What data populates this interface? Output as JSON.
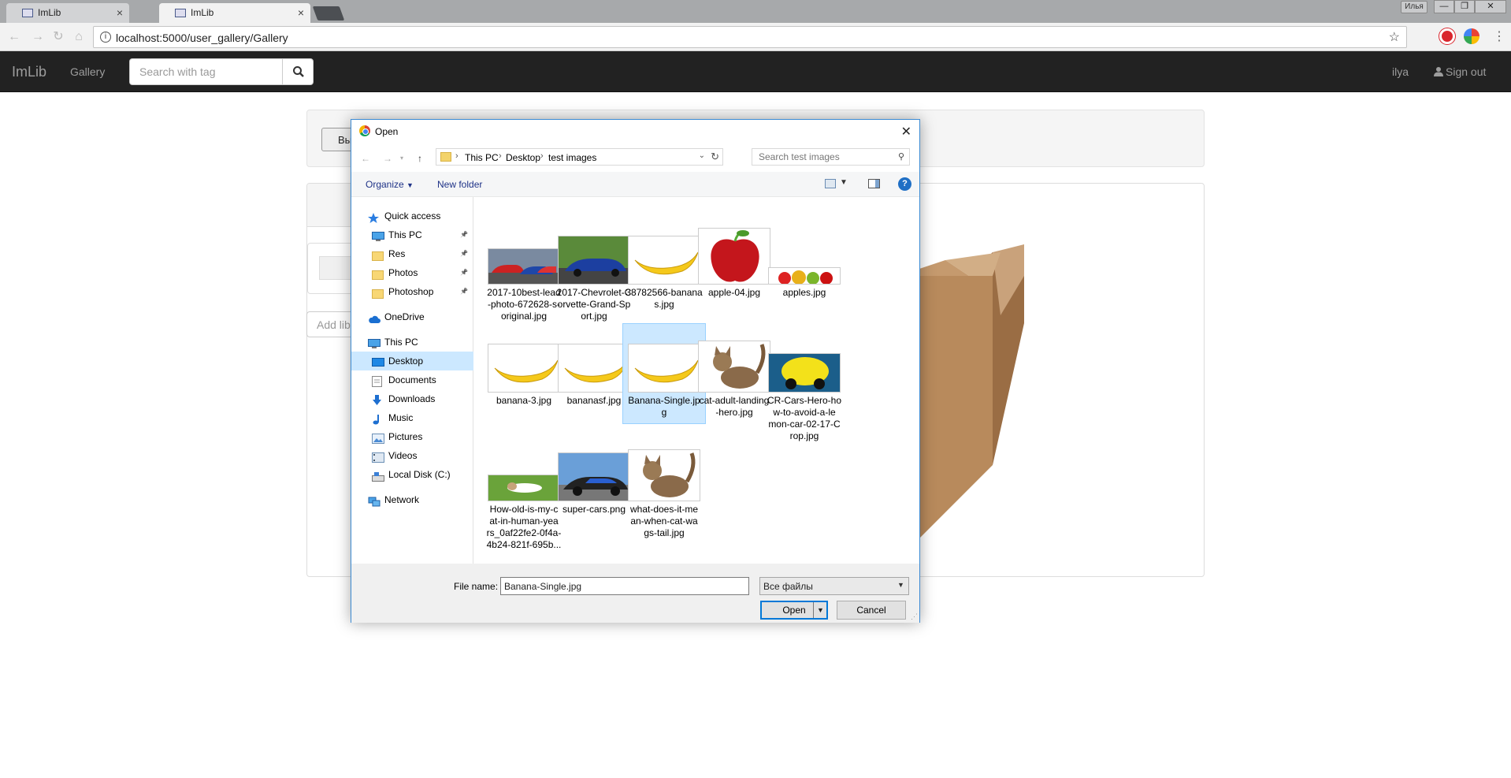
{
  "browser": {
    "tabs": [
      {
        "title": "ImLib",
        "close": "×"
      },
      {
        "title": "ImLib",
        "close": "×"
      }
    ],
    "profile_name": "Илья",
    "window_controls": {
      "minimize": "—",
      "maximize": "❐",
      "close": "✕"
    },
    "url": "localhost:5000/user_gallery/Gallery"
  },
  "site": {
    "brand": "ImLib",
    "nav_gallery": "Gallery",
    "search_placeholder": "Search with tag",
    "user": "ilya",
    "sign_out": "Sign out",
    "upload_button_partial": "Вы",
    "add_lib_partial": "Add lib"
  },
  "dialog": {
    "title": "Open",
    "breadcrumb": [
      "This PC",
      "Desktop",
      "test images"
    ],
    "search_placeholder": "Search test images",
    "organize": "Organize",
    "new_folder": "New folder",
    "help": "?",
    "nav_items": [
      {
        "label": "Quick access",
        "icon": "star-icon",
        "pinned": false
      },
      {
        "label": "This PC",
        "icon": "computer-icon",
        "pinned": true
      },
      {
        "label": "Res",
        "icon": "folder-icon",
        "pinned": true
      },
      {
        "label": "Photos",
        "icon": "folder-icon",
        "pinned": true
      },
      {
        "label": "Photoshop",
        "icon": "folder-icon",
        "pinned": true
      },
      {
        "label": "OneDrive",
        "icon": "cloud-icon",
        "pinned": false
      },
      {
        "label": "This PC",
        "icon": "computer-icon",
        "pinned": false
      },
      {
        "label": "Desktop",
        "icon": "desktop-icon",
        "pinned": false,
        "selected": true
      },
      {
        "label": "Documents",
        "icon": "documents-icon",
        "pinned": false
      },
      {
        "label": "Downloads",
        "icon": "downloads-icon",
        "pinned": false
      },
      {
        "label": "Music",
        "icon": "music-icon",
        "pinned": false
      },
      {
        "label": "Pictures",
        "icon": "pictures-icon",
        "pinned": false
      },
      {
        "label": "Videos",
        "icon": "videos-icon",
        "pinned": false
      },
      {
        "label": "Local Disk (C:)",
        "icon": "disk-icon",
        "pinned": false
      },
      {
        "label": "Network",
        "icon": "network-icon",
        "pinned": false
      }
    ],
    "files": [
      {
        "name": "2017-10best-lead-photo-672628-s-original.jpg",
        "lines": [
          "2017-10best-lead",
          "-photo-672628-s-",
          "original.jpg"
        ],
        "thumb": "red-cars"
      },
      {
        "name": "2017-Chevrolet-Corvette-Grand-Sport.jpg",
        "lines": [
          "2017-Chevrolet-C",
          "orvette-Grand-Sp",
          "ort.jpg"
        ],
        "thumb": "blue-car"
      },
      {
        "name": "38782566-bananas.jpg",
        "lines": [
          "38782566-banana",
          "s.jpg"
        ],
        "thumb": "banana"
      },
      {
        "name": "apple-04.jpg",
        "lines": [
          "apple-04.jpg"
        ],
        "thumb": "apple"
      },
      {
        "name": "apples.jpg",
        "lines": [
          "apples.jpg"
        ],
        "thumb": "apples"
      },
      {
        "name": "banana-3.jpg",
        "lines": [
          "banana-3.jpg"
        ],
        "thumb": "banana"
      },
      {
        "name": "bananasf.jpg",
        "lines": [
          "bananasf.jpg"
        ],
        "thumb": "banana"
      },
      {
        "name": "Banana-Single.jpg",
        "lines": [
          "Banana-Single.jp",
          "g"
        ],
        "thumb": "banana",
        "selected": true
      },
      {
        "name": "cat-adult-landing-hero.jpg",
        "lines": [
          "cat-adult-landing",
          "-hero.jpg"
        ],
        "thumb": "cat"
      },
      {
        "name": "CR-Cars-Hero-how-to-avoid-a-lemon-car-02-17-Crop.jpg",
        "lines": [
          "CR-Cars-Hero-ho",
          "w-to-avoid-a-le",
          "mon-car-02-17-C",
          "rop.jpg"
        ],
        "thumb": "lemon-car"
      },
      {
        "name": "How-old-is-my-cat-in-human-years_0af22fe2-0f4a-4b24-821f-695b...",
        "lines": [
          "How-old-is-my-c",
          "at-in-human-yea",
          "rs_0af22fe2-0f4a-",
          "4b24-821f-695b..."
        ],
        "thumb": "cat-grass"
      },
      {
        "name": "super-cars.png",
        "lines": [
          "super-cars.png"
        ],
        "thumb": "supercar"
      },
      {
        "name": "what-does-it-mean-when-cat-wags-tail.jpg",
        "lines": [
          "what-does-it-me",
          "an-when-cat-wa",
          "gs-tail.jpg"
        ],
        "thumb": "cat"
      }
    ],
    "file_name_label": "File name:",
    "file_name_value": "Banana-Single.jpg",
    "file_type": "Все файлы",
    "open_button": "Open",
    "cancel_button": "Cancel"
  },
  "colors": {
    "navbar_bg": "#222222",
    "selection": "#cce8ff",
    "dialog_border": "#3c8bd4",
    "accent": "#0078d7"
  }
}
